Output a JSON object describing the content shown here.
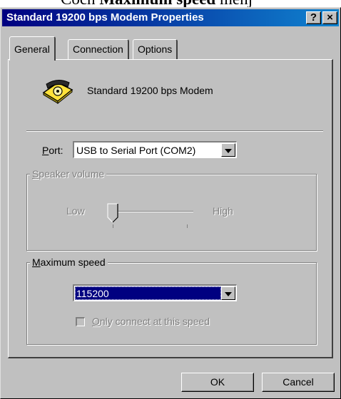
{
  "background_caption": {
    "pre": "Coch",
    "bold": "Maximum speed",
    "post": "menj"
  },
  "window": {
    "title": "Standard 19200 bps Modem Properties",
    "help_glyph": "?",
    "close_glyph": "×"
  },
  "tabs": [
    {
      "label": "General",
      "active": true
    },
    {
      "label": "Connection",
      "active": false
    },
    {
      "label": "Options",
      "active": false
    }
  ],
  "general": {
    "modem_name": "Standard 19200 bps Modem",
    "port": {
      "label_mnemonic": "P",
      "label_rest": "ort:",
      "value": "USB to Serial Port (COM2)"
    },
    "speaker_volume": {
      "label_mnemonic": "S",
      "label_rest": "peaker volume",
      "low": "Low",
      "high": "High",
      "level": 0,
      "enabled": false
    },
    "max_speed": {
      "label_mnemonic": "M",
      "label_rest": "aximum speed",
      "value": "115200",
      "only_connect_mnemonic": "O",
      "only_connect_rest": "nly connect at this speed",
      "only_connect_checked": false,
      "only_connect_enabled": false
    }
  },
  "buttons": {
    "ok": "OK",
    "cancel": "Cancel"
  },
  "colors": {
    "title_start": "#000080",
    "title_end": "#1084d0",
    "face": "#c0c0c0",
    "highlight": "#000080"
  }
}
